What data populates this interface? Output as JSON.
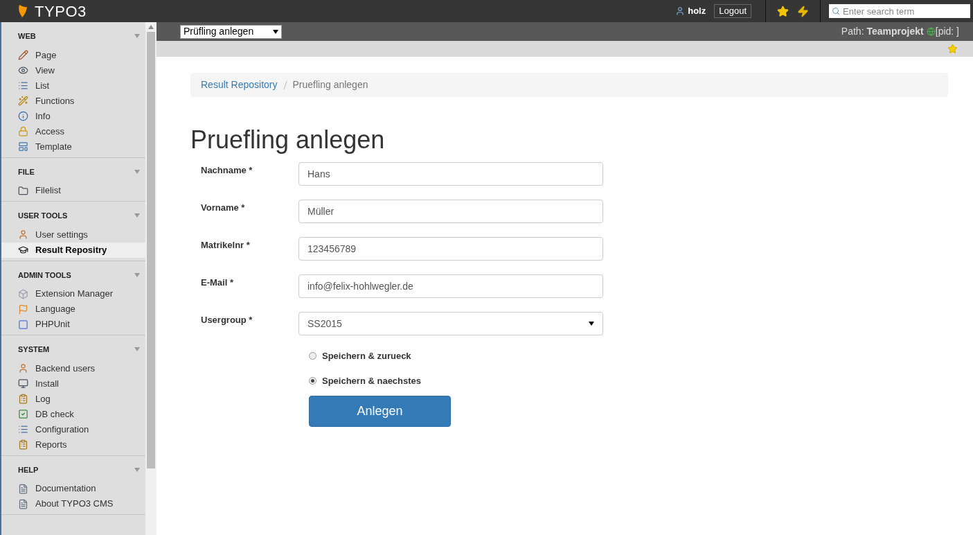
{
  "topbar": {
    "logo": "TYPO3",
    "user": "holz",
    "logout": "Logout",
    "search": {
      "placeholder": "Enter search term"
    }
  },
  "sidebar": [
    {
      "title": "WEB",
      "items": [
        {
          "label": "Page",
          "selected": false
        },
        {
          "label": "View",
          "selected": false
        },
        {
          "label": "List",
          "selected": false
        },
        {
          "label": "Functions",
          "selected": false
        },
        {
          "label": "Info",
          "selected": false
        },
        {
          "label": "Access",
          "selected": false
        },
        {
          "label": "Template",
          "selected": false
        }
      ]
    },
    {
      "title": "FILE",
      "items": [
        {
          "label": "Filelist",
          "selected": false
        }
      ]
    },
    {
      "title": "USER TOOLS",
      "items": [
        {
          "label": "User settings",
          "selected": false
        },
        {
          "label": "Result Repositry",
          "selected": true
        }
      ]
    },
    {
      "title": "ADMIN TOOLS",
      "items": [
        {
          "label": "Extension Manager",
          "selected": false
        },
        {
          "label": "Language",
          "selected": false
        },
        {
          "label": "PHPUnit",
          "selected": false
        }
      ]
    },
    {
      "title": "SYSTEM",
      "items": [
        {
          "label": "Backend users",
          "selected": false
        },
        {
          "label": "Install",
          "selected": false
        },
        {
          "label": "Log",
          "selected": false
        },
        {
          "label": "DB check",
          "selected": false
        },
        {
          "label": "Configuration",
          "selected": false
        },
        {
          "label": "Reports",
          "selected": false
        }
      ]
    },
    {
      "title": "HELP",
      "items": [
        {
          "label": "Documentation",
          "selected": false
        },
        {
          "label": "About TYPO3 CMS",
          "selected": false
        }
      ]
    }
  ],
  "docheader": {
    "menu": "Prüfling anlegen",
    "path_label": "Path:",
    "path_page": "Teamprojekt",
    "path_pid": "[pid: ]"
  },
  "breadcrumb": [
    {
      "label": "Result Repository",
      "kind": "link"
    },
    {
      "label": "Pruefling anlegen",
      "kind": "current"
    }
  ],
  "heading": "Pruefling anlegen",
  "form": {
    "fields": [
      {
        "label": "Nachname *",
        "value": "Hans",
        "kind": "text"
      },
      {
        "label": "Vorname *",
        "value": "Müller",
        "kind": "text"
      },
      {
        "label": "Matrikelnr *",
        "value": "123456789",
        "kind": "text"
      },
      {
        "label": "E-Mail *",
        "value": "info@felix-hohlwegler.de",
        "kind": "text"
      },
      {
        "label": "Usergroup *",
        "value": "SS2015",
        "kind": "select"
      }
    ],
    "options": [
      {
        "label": "Speichern & zurueck",
        "selected": false
      },
      {
        "label": "Speichern & naechstes",
        "selected": true
      }
    ],
    "submit": "Anlegen"
  }
}
